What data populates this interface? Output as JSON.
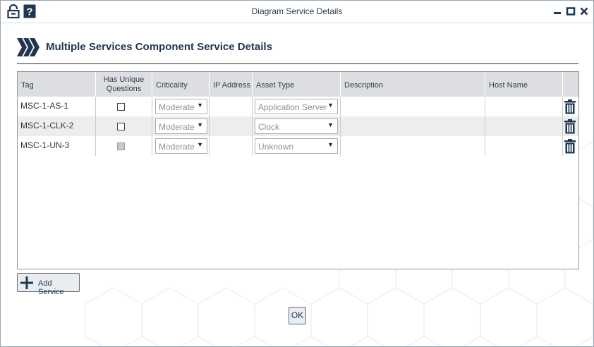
{
  "window": {
    "title": "Diagram Service Details",
    "lock_icon": "lock-icon",
    "help_icon": "help-icon",
    "controls": [
      "minimize-icon",
      "maximize-icon",
      "close-icon"
    ]
  },
  "header": {
    "title": "Multiple Services Component Service Details",
    "logo_icon": "chevrons-logo"
  },
  "table": {
    "columns": {
      "tag": "Tag",
      "unique_questions_line1": "Has Unique",
      "unique_questions_line2": "Questions",
      "criticality": "Criticality",
      "ip_address": "IP Address",
      "asset_type": "Asset Type",
      "description": "Description",
      "host_name": "Host Name"
    },
    "rows": [
      {
        "tag": "MSC-1-AS-1",
        "unique_questions": false,
        "checkbox_enabled": true,
        "criticality": "Moderate",
        "ip_address": "",
        "asset_type": "Application Server",
        "description": "",
        "host_name": "",
        "delete_icon": "trash-icon"
      },
      {
        "tag": "MSC-1-CLK-2",
        "unique_questions": false,
        "checkbox_enabled": true,
        "criticality": "Moderate",
        "ip_address": "",
        "asset_type": "Clock",
        "description": "",
        "host_name": "",
        "delete_icon": "trash-icon"
      },
      {
        "tag": "MSC-1-UN-3",
        "unique_questions": false,
        "checkbox_enabled": false,
        "criticality": "Moderate",
        "ip_address": "",
        "asset_type": "Unknown",
        "description": "",
        "host_name": "",
        "delete_icon": "trash-icon"
      }
    ]
  },
  "buttons": {
    "add_service": "Add Service",
    "add_icon": "plus-icon",
    "ok": "OK"
  },
  "colors": {
    "accent": "#1f3550",
    "header_bg": "#dcdee1",
    "alt_row": "#ededee"
  }
}
